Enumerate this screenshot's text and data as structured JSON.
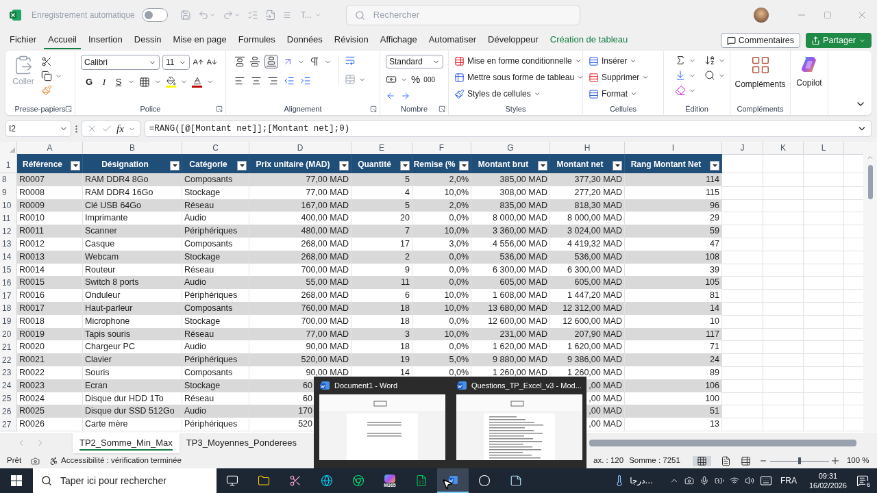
{
  "titlebar": {
    "autosave_label": "Enregistrement automatique",
    "autosave_on": false,
    "file_name": "T...",
    "search_placeholder": "Rechercher"
  },
  "menu_tabs": [
    {
      "label": "Fichier",
      "selected": false,
      "kind": "normal"
    },
    {
      "label": "Accueil",
      "selected": true,
      "kind": "normal"
    },
    {
      "label": "Insertion",
      "selected": false,
      "kind": "normal"
    },
    {
      "label": "Dessin",
      "selected": false,
      "kind": "normal"
    },
    {
      "label": "Mise en page",
      "selected": false,
      "kind": "normal"
    },
    {
      "label": "Formules",
      "selected": false,
      "kind": "normal"
    },
    {
      "label": "Données",
      "selected": false,
      "kind": "normal"
    },
    {
      "label": "Révision",
      "selected": false,
      "kind": "normal"
    },
    {
      "label": "Affichage",
      "selected": false,
      "kind": "normal"
    },
    {
      "label": "Automatiser",
      "selected": false,
      "kind": "normal"
    },
    {
      "label": "Développeur",
      "selected": false,
      "kind": "normal"
    },
    {
      "label": "Création de tableau",
      "selected": false,
      "kind": "contextual"
    }
  ],
  "comments_button": "Commentaires",
  "share_button": "Partager",
  "ribbon": {
    "clipboard": {
      "paste": "Coller",
      "group": "Presse-papiers"
    },
    "font": {
      "name": "Calibri",
      "size": "11",
      "bold": "G",
      "italic": "I",
      "underline": "S",
      "group": "Police"
    },
    "alignment": {
      "group": "Alignement"
    },
    "number": {
      "format": "Standard",
      "percent": "%",
      "thousands": "000",
      "group": "Nombre"
    },
    "styles": {
      "items": [
        "Mise en forme conditionnelle",
        "Mettre sous forme de tableau",
        "Styles de cellules"
      ],
      "group": "Styles"
    },
    "cells": {
      "items": [
        "Insérer",
        "Supprimer",
        "Format"
      ],
      "group": "Cellules"
    },
    "editing": {
      "group": "Édition"
    },
    "addins": {
      "button": "Compléments",
      "group": "Compléments"
    },
    "copilot": "Copilot"
  },
  "formula_bar": {
    "cell_ref": "I2",
    "fx": "fx",
    "formula": "=RANG([@[Montant net]];[Montant net];0)"
  },
  "header_row": "1",
  "column_letters": [
    "A",
    "B",
    "C",
    "D",
    "E",
    "F",
    "G",
    "H",
    "I",
    "J",
    "K",
    "L"
  ],
  "table": {
    "columns": [
      "Référence",
      "Désignation",
      "Catégorie",
      "Prix unitaire (MAD)",
      "Quantité",
      "Remise (%",
      "Montant brut",
      "Montant net",
      "Rang Montant Net"
    ],
    "rows": [
      {
        "row": "8",
        "a": "R0007",
        "b": "RAM DDR4 8Go",
        "c": "Composants",
        "d": "77,00 MAD",
        "e": "5",
        "f": "2,0%",
        "g": "385,00 MAD",
        "h": "377,30 MAD",
        "i": "114"
      },
      {
        "row": "9",
        "a": "R0008",
        "b": "RAM DDR4 16Go",
        "c": "Stockage",
        "d": "77,00 MAD",
        "e": "4",
        "f": "10,0%",
        "g": "308,00 MAD",
        "h": "277,20 MAD",
        "i": "115"
      },
      {
        "row": "10",
        "a": "R0009",
        "b": "Clé USB 64Go",
        "c": "Réseau",
        "d": "167,00 MAD",
        "e": "5",
        "f": "2,0%",
        "g": "835,00 MAD",
        "h": "818,30 MAD",
        "i": "96"
      },
      {
        "row": "11",
        "a": "R0010",
        "b": "Imprimante",
        "c": "Audio",
        "d": "400,00 MAD",
        "e": "20",
        "f": "0,0%",
        "g": "8 000,00 MAD",
        "h": "8 000,00 MAD",
        "i": "29"
      },
      {
        "row": "12",
        "a": "R0011",
        "b": "Scanner",
        "c": "Périphériques",
        "d": "480,00 MAD",
        "e": "7",
        "f": "10,0%",
        "g": "3 360,00 MAD",
        "h": "3 024,00 MAD",
        "i": "59"
      },
      {
        "row": "13",
        "a": "R0012",
        "b": "Casque",
        "c": "Composants",
        "d": "268,00 MAD",
        "e": "17",
        "f": "3,0%",
        "g": "4 556,00 MAD",
        "h": "4 419,32 MAD",
        "i": "47"
      },
      {
        "row": "14",
        "a": "R0013",
        "b": "Webcam",
        "c": "Stockage",
        "d": "268,00 MAD",
        "e": "2",
        "f": "0,0%",
        "g": "536,00 MAD",
        "h": "536,00 MAD",
        "i": "108"
      },
      {
        "row": "15",
        "a": "R0014",
        "b": "Routeur",
        "c": "Réseau",
        "d": "700,00 MAD",
        "e": "9",
        "f": "0,0%",
        "g": "6 300,00 MAD",
        "h": "6 300,00 MAD",
        "i": "39"
      },
      {
        "row": "16",
        "a": "R0015",
        "b": "Switch 8 ports",
        "c": "Audio",
        "d": "55,00 MAD",
        "e": "11",
        "f": "0,0%",
        "g": "605,00 MAD",
        "h": "605,00 MAD",
        "i": "105"
      },
      {
        "row": "17",
        "a": "R0016",
        "b": "Onduleur",
        "c": "Périphériques",
        "d": "268,00 MAD",
        "e": "6",
        "f": "10,0%",
        "g": "1 608,00 MAD",
        "h": "1 447,20 MAD",
        "i": "81"
      },
      {
        "row": "18",
        "a": "R0017",
        "b": "Haut-parleur",
        "c": "Composants",
        "d": "760,00 MAD",
        "e": "18",
        "f": "10,0%",
        "g": "13 680,00 MAD",
        "h": "12 312,00 MAD",
        "i": "14"
      },
      {
        "row": "19",
        "a": "R0018",
        "b": "Microphone",
        "c": "Stockage",
        "d": "700,00 MAD",
        "e": "18",
        "f": "0,0%",
        "g": "12 600,00 MAD",
        "h": "12 600,00 MAD",
        "i": "10"
      },
      {
        "row": "20",
        "a": "R0019",
        "b": "Tapis souris",
        "c": "Réseau",
        "d": "77,00 MAD",
        "e": "3",
        "f": "10,0%",
        "g": "231,00 MAD",
        "h": "207,90 MAD",
        "i": "117"
      },
      {
        "row": "21",
        "a": "R0020",
        "b": "Chargeur PC",
        "c": "Audio",
        "d": "90,00 MAD",
        "e": "18",
        "f": "0,0%",
        "g": "1 620,00 MAD",
        "h": "1 620,00 MAD",
        "i": "71"
      },
      {
        "row": "22",
        "a": "R0021",
        "b": "Clavier",
        "c": "Périphériques",
        "d": "520,00 MAD",
        "e": "19",
        "f": "5,0%",
        "g": "9 880,00 MAD",
        "h": "9 386,00 MAD",
        "i": "24"
      },
      {
        "row": "23",
        "a": "R0022",
        "b": "Souris",
        "c": "Composants",
        "d": "90,00 MAD",
        "e": "14",
        "f": "0,0%",
        "g": "1 260,00 MAD",
        "h": "1 260,00 MAD",
        "i": "89"
      },
      {
        "row": "24",
        "a": "R0023",
        "b": "Ecran",
        "c": "Stockage",
        "d": "60",
        "h": ",00 MAD",
        "i": "106",
        "covered": true
      },
      {
        "row": "25",
        "a": "R0024",
        "b": "Disque dur HDD 1To",
        "c": "Réseau",
        "d": "60",
        "h": ",00 MAD",
        "i": "100",
        "covered": true
      },
      {
        "row": "26",
        "a": "R0025",
        "b": "Disque dur SSD 512Go",
        "c": "Audio",
        "d": "170",
        "h": ",00 MAD",
        "i": "51",
        "covered": true
      },
      {
        "row": "27",
        "a": "R0026",
        "b": "Carte mère",
        "c": "Périphériques",
        "d": "520",
        "h": ",00 MAD",
        "i": "13",
        "covered": true
      }
    ]
  },
  "sheet_tabs": [
    {
      "label": "TP2_Somme_Min_Max",
      "selected": true
    },
    {
      "label": "TP3_Moyennes_Ponderees",
      "selected": false
    }
  ],
  "status_bar": {
    "mode": "Prêt",
    "accessibility": "Accessibilité : vérification terminée",
    "max": "ax. : 120",
    "sum": "Somme : 7251",
    "zoom": "100 %",
    "zoom_slider": {
      "level": 0.5
    }
  },
  "taskbar_preview": [
    {
      "title": "Document1 - Word"
    },
    {
      "title": "Questions_TP_Excel_v3  -  Mod..."
    }
  ],
  "taskbar": {
    "search_placeholder": "Taper ici pour rechercher",
    "m365_label": "M365",
    "weather": "درجا...",
    "language": "FRA",
    "time": "09:31",
    "date": "16/02/2026",
    "notifications": "6"
  }
}
